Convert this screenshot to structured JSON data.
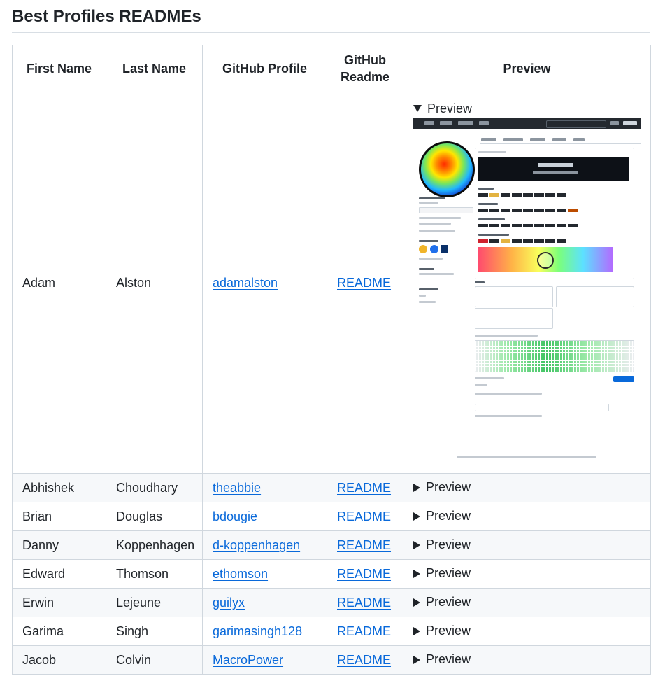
{
  "page": {
    "title": "Best Profiles READMEs"
  },
  "table": {
    "headers": [
      "First Name",
      "Last Name",
      "GitHub Profile",
      "GitHub Readme",
      "Preview"
    ],
    "rows": [
      {
        "first": "Adam",
        "last": "Alston",
        "profile": "adamalston",
        "readme": "README",
        "preview": "Preview",
        "expanded": true
      },
      {
        "first": "Abhishek",
        "last": "Choudhary",
        "profile": "theabbie",
        "readme": "README",
        "preview": "Preview",
        "expanded": false
      },
      {
        "first": "Brian",
        "last": "Douglas",
        "profile": "bdougie",
        "readme": "README",
        "preview": "Preview",
        "expanded": false
      },
      {
        "first": "Danny",
        "last": "Koppenhagen",
        "profile": "d-koppenhagen",
        "readme": "README",
        "preview": "Preview",
        "expanded": false
      },
      {
        "first": "Edward",
        "last": "Thomson",
        "profile": "ethomson",
        "readme": "README",
        "preview": "Preview",
        "expanded": false
      },
      {
        "first": "Erwin",
        "last": "Lejeune",
        "profile": "guilyx",
        "readme": "README",
        "preview": "Preview",
        "expanded": false
      },
      {
        "first": "Garima",
        "last": "Singh",
        "profile": "garimasingh128",
        "readme": "README",
        "preview": "Preview",
        "expanded": false
      },
      {
        "first": "Jacob",
        "last": "Colvin",
        "profile": "MacroPower",
        "readme": "README",
        "preview": "Preview",
        "expanded": false
      }
    ]
  },
  "screenshot": {
    "name": "Adam Alston",
    "role": "Software Engineer"
  },
  "colors": {
    "link": "#0969da",
    "border": "#d0d7de",
    "stripe": "#f6f8fa"
  }
}
